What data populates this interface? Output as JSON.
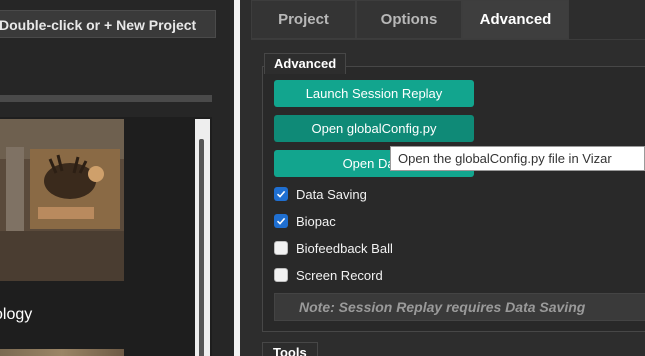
{
  "left_panel": {
    "hint_text": "Double-click or + New Project",
    "item_label": "ology"
  },
  "tabs": [
    {
      "label": "Project",
      "active": false
    },
    {
      "label": "Options",
      "active": false
    },
    {
      "label": "Advanced",
      "active": true
    }
  ],
  "advanced": {
    "group_title": "Advanced",
    "buttons": {
      "launch_session_replay": "Launch Session Replay",
      "open_global_config": "Open globalConfig.py",
      "open_data": "Open Data"
    },
    "checkboxes": [
      {
        "label": "Data Saving",
        "checked": true
      },
      {
        "label": "Biopac",
        "checked": true
      },
      {
        "label": "Biofeedback Ball",
        "checked": false
      },
      {
        "label": "Screen Record",
        "checked": false
      }
    ],
    "note": "Note: Session Replay requires Data Saving"
  },
  "tools": {
    "group_title": "Tools"
  },
  "tooltip": {
    "text": "Open the globalConfig.py file in Vizar"
  },
  "colors": {
    "accent_button": "#12a58e",
    "accent_button_hover": "#0f8a77",
    "checkbox_checked": "#1f6fd1"
  },
  "icons": {
    "check": "check-icon",
    "image_thumbnail": "project-thumbnail"
  }
}
